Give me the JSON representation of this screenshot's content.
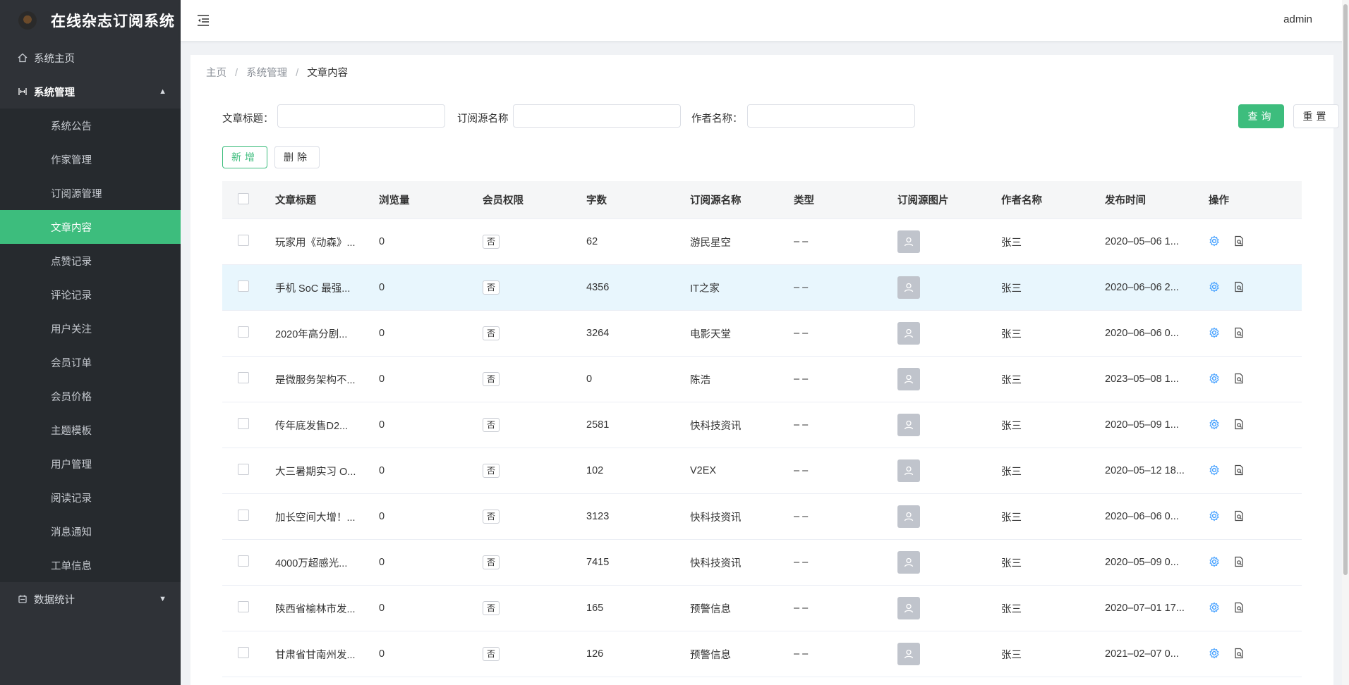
{
  "app": {
    "title": "在线杂志订阅系统"
  },
  "header": {
    "user": "admin"
  },
  "sidebar": {
    "home": "系统主页",
    "system": "系统管理",
    "system_items": [
      "系统公告",
      "作家管理",
      "订阅源管理",
      "文章内容",
      "点赞记录",
      "评论记录",
      "用户关注",
      "会员订单",
      "会员价格",
      "主题模板",
      "用户管理",
      "阅读记录",
      "消息通知",
      "工单信息"
    ],
    "stats": "数据统计"
  },
  "breadcrumb": {
    "home": "主页",
    "parent": "系统管理",
    "current": "文章内容"
  },
  "search": {
    "title_label": "文章标题：",
    "source_label": "订阅源名称",
    "author_label": "作者名称：",
    "query_label": "查询",
    "reset_label": "重置"
  },
  "actions": {
    "add_label": "新增",
    "delete_label": "删除"
  },
  "table": {
    "columns": [
      "文章标题",
      "浏览量",
      "会员权限",
      "字数",
      "订阅源名称",
      "类型",
      "订阅源图片",
      "作者名称",
      "发布时间",
      "操作"
    ],
    "rows": [
      {
        "title": "玩家用《动森》...",
        "views": "0",
        "vip": "否",
        "words": "62",
        "source": "游民星空",
        "type": "– –",
        "author": "张三",
        "time": "2020–05–06 1..."
      },
      {
        "title": "手机 SoC 最强...",
        "views": "0",
        "vip": "否",
        "words": "4356",
        "source": "IT之家",
        "type": "– –",
        "author": "张三",
        "time": "2020–06–06 2..."
      },
      {
        "title": "2020年高分剧...",
        "views": "0",
        "vip": "否",
        "words": "3264",
        "source": "电影天堂",
        "type": "– –",
        "author": "张三",
        "time": "2020–06–06 0..."
      },
      {
        "title": "是微服务架构不...",
        "views": "0",
        "vip": "否",
        "words": "0",
        "source": "陈浩",
        "type": "– –",
        "author": "张三",
        "time": "2023–05–08 1..."
      },
      {
        "title": "传年底发售D2...",
        "views": "0",
        "vip": "否",
        "words": "2581",
        "source": "快科技资讯",
        "type": "– –",
        "author": "张三",
        "time": "2020–05–09 1..."
      },
      {
        "title": "大三暑期实习 O...",
        "views": "0",
        "vip": "否",
        "words": "102",
        "source": "V2EX",
        "type": "– –",
        "author": "张三",
        "time": "2020–05–12 18..."
      },
      {
        "title": "加长空间大增！...",
        "views": "0",
        "vip": "否",
        "words": "3123",
        "source": "快科技资讯",
        "type": "– –",
        "author": "张三",
        "time": "2020–06–06 0..."
      },
      {
        "title": "4000万超感光...",
        "views": "0",
        "vip": "否",
        "words": "7415",
        "source": "快科技资讯",
        "type": "– –",
        "author": "张三",
        "time": "2020–05–09 0..."
      },
      {
        "title": "陕西省榆林市发...",
        "views": "0",
        "vip": "否",
        "words": "165",
        "source": "预警信息",
        "type": "– –",
        "author": "张三",
        "time": "2020–07–01 17..."
      },
      {
        "title": "甘肃省甘南州发...",
        "views": "0",
        "vip": "否",
        "words": "126",
        "source": "预警信息",
        "type": "– –",
        "author": "张三",
        "time": "2021–02–07 0..."
      }
    ]
  },
  "colors": {
    "accent": "#3dbd7d",
    "sidebar_bg": "#2f3237",
    "icon_blue": "#409eff"
  }
}
